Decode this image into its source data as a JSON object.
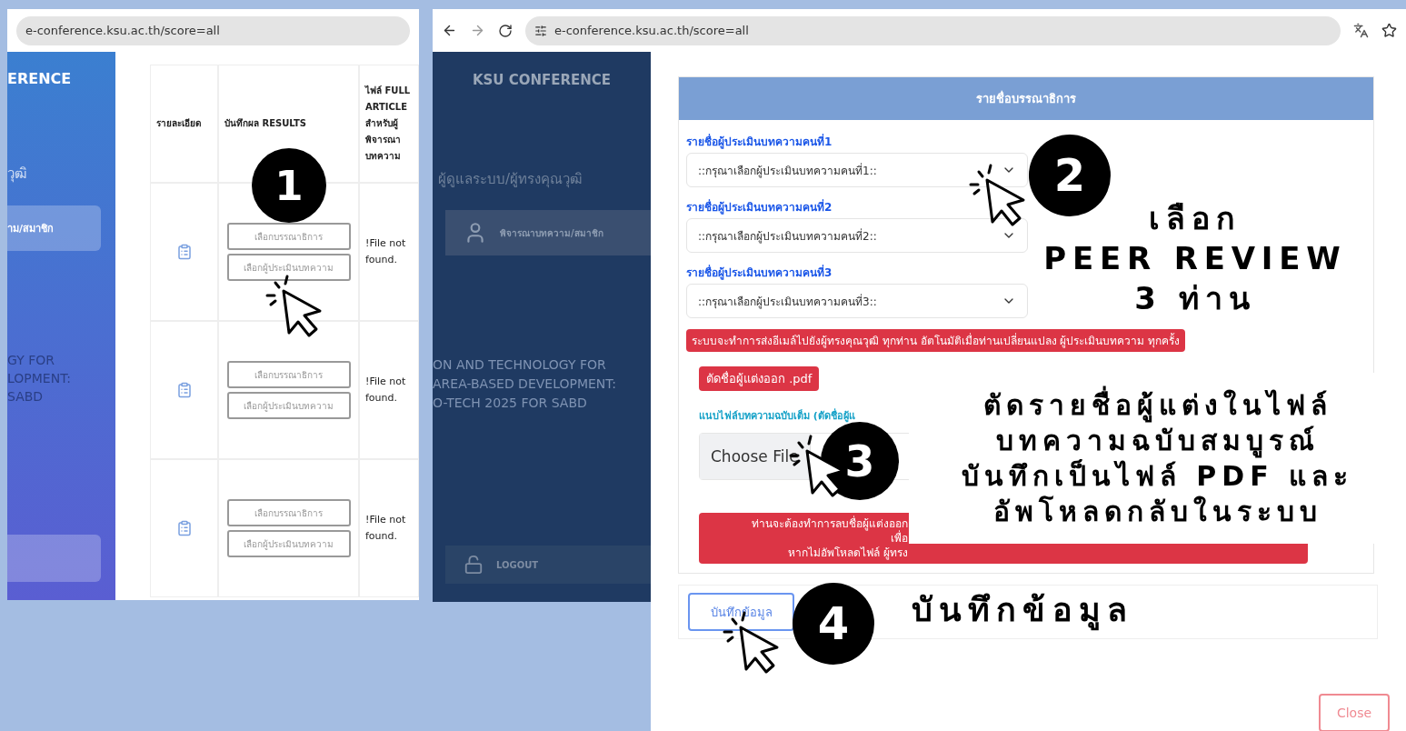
{
  "left_window": {
    "url": "e-conference.ksu.ac.th/score=all",
    "sidebar": {
      "title": "ERENCE",
      "items": [
        {
          "label": "วุฒิ",
          "selected": false
        },
        {
          "label": "าม/สมาชิก",
          "selected": true
        }
      ],
      "caption": [
        "GY FOR",
        "LOPMENT:",
        "SABD"
      ]
    },
    "table": {
      "columns": [
        "รายละเอียด",
        "บันทึกผล RESULTS",
        "ไฟล์ FULL ARTICLE สำหรับผู้พิจารณาบทความ"
      ],
      "rows": [
        {
          "buttons": [
            "เลือกบรรณาธิการ",
            "เลือกผู้ประเมินบทความ"
          ],
          "file": "!File not found."
        },
        {
          "buttons": [
            "เลือกบรรณาธิการ",
            "เลือกผู้ประเมินบทความ"
          ],
          "file": "!File not found."
        },
        {
          "buttons": [
            "เลือกบรรณาธิการ",
            "เลือกผู้ประเมินบทความ"
          ],
          "file": "!File not found."
        }
      ]
    }
  },
  "right_window": {
    "url": "e-conference.ksu.ac.th/score=all",
    "sidebar": {
      "title": "KSU CONFERENCE",
      "section": "ผู้ดูแลระบบ/ผู้ทรงคุณวุฒิ",
      "items": [
        {
          "label": "พิจารณาบทความ/สมาชิก",
          "selected": true
        }
      ],
      "caption": [
        "ON AND TECHNOLOGY FOR",
        "AREA-BASED DEVELOPMENT:",
        "O-TECH 2025 FOR SABD"
      ],
      "logout": "LOGOUT"
    },
    "modal": {
      "title": "รายชื่อบรรณาธิการ",
      "reviewers": [
        {
          "label": "รายชื่อผู้ประเมินบทความคนที่1",
          "value": "::กรุณาเลือกผู้ประเมินบทความคนที่1::"
        },
        {
          "label": "รายชื่อผู้ประเมินบทความคนที่2",
          "value": "::กรุณาเลือกผู้ประเมินบทความคนที่2::"
        },
        {
          "label": "รายชื่อผู้ประเมินบทความคนที่3",
          "value": "::กรุณาเลือกผู้ประเมินบทความคนที่3::"
        }
      ],
      "notice": "ระบบจะทำการส่งอีเมล์ไปยังผู้ทรงคุณวุฒิ ทุกท่าน อัตโนมัติเมื่อท่านเปลี่ยนแปลง ผู้ประเมินบทความ ทุกครั้ง",
      "pdf_button": "ตัดชื่อผู้แต่งออก .pdf",
      "attach_label": "แนบไฟล์บทความฉบับเต็ม (ตัดชื่อผู้แ",
      "file_button": "Choose File",
      "warning": [
        "ท่านจะต้องทำการลบชื่อผู้แต่งออก",
        "เพื่อ",
        "หากไม่อัพโหลดไฟล์ ผู้ทรง"
      ],
      "save_button": "บันทึกข้อมูล",
      "close_button": "Close"
    }
  },
  "callouts": [
    {
      "number": "1"
    },
    {
      "number": "2",
      "lines": [
        "เลือก",
        "PEER REVIEW",
        "3 ท่าน"
      ]
    },
    {
      "number": "3",
      "lines": [
        "ตัดรายชื่อผู้แต่งในไฟล์",
        "บทความฉบับสมบูรณ์",
        "บันทึกเป็นไฟล์ PDF และ",
        "อัพโหลดกลับในระบบ"
      ]
    },
    {
      "number": "4",
      "lines": [
        "บันทึกข้อมูล"
      ]
    }
  ]
}
